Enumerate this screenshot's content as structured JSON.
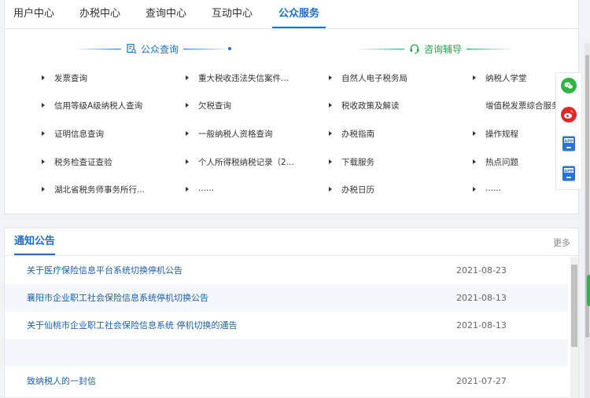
{
  "tabs": [
    "用户中心",
    "办税中心",
    "查询中心",
    "互动中心",
    "公众服务"
  ],
  "sections": {
    "public_query": {
      "title": "公众查询",
      "icon": "document-search-icon"
    },
    "consult": {
      "title": "咨询辅导",
      "icon": "headset-icon"
    }
  },
  "links": {
    "col1": [
      "发票查询",
      "信用等级A级纳税人查询",
      "证明信息查询",
      "税务检查证查验",
      "湖北省税务师事务所行..."
    ],
    "col2": [
      "重大税收违法失信案件...",
      "欠税查询",
      "一般纳税人资格查询",
      "个人所得税纳税记录（2...",
      "......"
    ],
    "col3": [
      "自然人电子税务局",
      "税收政策及解读",
      "办税指南",
      "下载服务",
      "办税日历"
    ],
    "col4": [
      "纳税人学堂",
      "增值税发票综合服务",
      "操作规程",
      "热点问题",
      "......"
    ]
  },
  "side_buttons": {
    "wechat": "wechat-icon",
    "weibo": "weibo-icon",
    "app1": "APP",
    "app2": "APP"
  },
  "notices": {
    "title": "通知公告",
    "more": "更多",
    "items": [
      {
        "title": "关于医疗保险信息平台系统切换停机公告",
        "date": "2021-08-23"
      },
      {
        "title": "襄阳市企业职工社会保险信息系统停机切换公告",
        "date": "2021-08-13"
      },
      {
        "title": "关于仙桃市企业职工社会保险信息系统 停机切换的通告",
        "date": "2021-08-13"
      },
      {
        "title": "",
        "date": ""
      },
      {
        "title": "致纳税人的一封信",
        "date": "2021-07-27"
      }
    ]
  },
  "colors": {
    "primary": "#1a6fd6",
    "green": "#1fa84a",
    "link": "#1f5fad"
  }
}
